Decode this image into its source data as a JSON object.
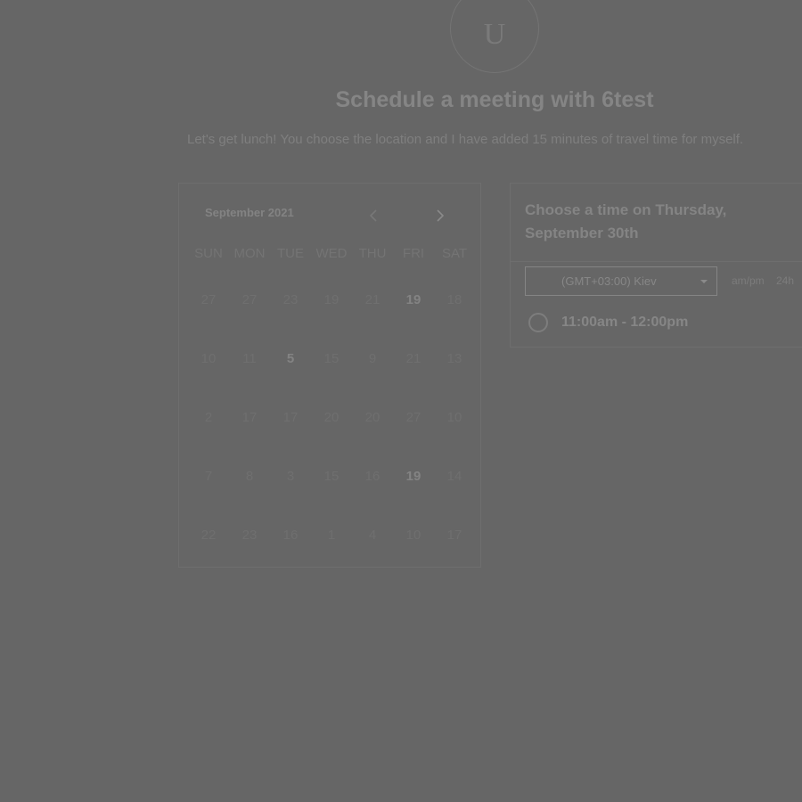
{
  "header": {
    "avatar_letter": "U",
    "title": "Schedule a meeting with 6test",
    "subtitle": "Let's get lunch! You choose the location and I have added 15 minutes of travel time for myself."
  },
  "calendar": {
    "month_label": "September 2021",
    "prev_icon": "chevron-left-icon",
    "next_icon": "chevron-right-icon",
    "weekdays": [
      "SUN",
      "MON",
      "TUE",
      "WED",
      "THU",
      "FRI",
      "SAT"
    ],
    "weeks": [
      [
        "27",
        "27",
        "23",
        "19",
        "21",
        "19",
        "18"
      ],
      [
        "10",
        "11",
        "5",
        "15",
        "9",
        "21",
        "13"
      ],
      [
        "2",
        "17",
        "17",
        "20",
        "20",
        "27",
        "10"
      ],
      [
        "7",
        "8",
        "3",
        "15",
        "16",
        "19",
        "14"
      ],
      [
        "22",
        "23",
        "16",
        "1",
        "4",
        "10",
        "17"
      ]
    ],
    "available": [
      [
        0,
        5
      ],
      [
        1,
        2
      ],
      [
        3,
        5
      ]
    ]
  },
  "times": {
    "heading": "Choose a time on Thursday, September 30th",
    "timezone": "(GMT+03:00) Kiev",
    "format_ampm": "am/pm",
    "format_24h": "24h",
    "slots": [
      "11:00am - 12:00pm"
    ]
  }
}
